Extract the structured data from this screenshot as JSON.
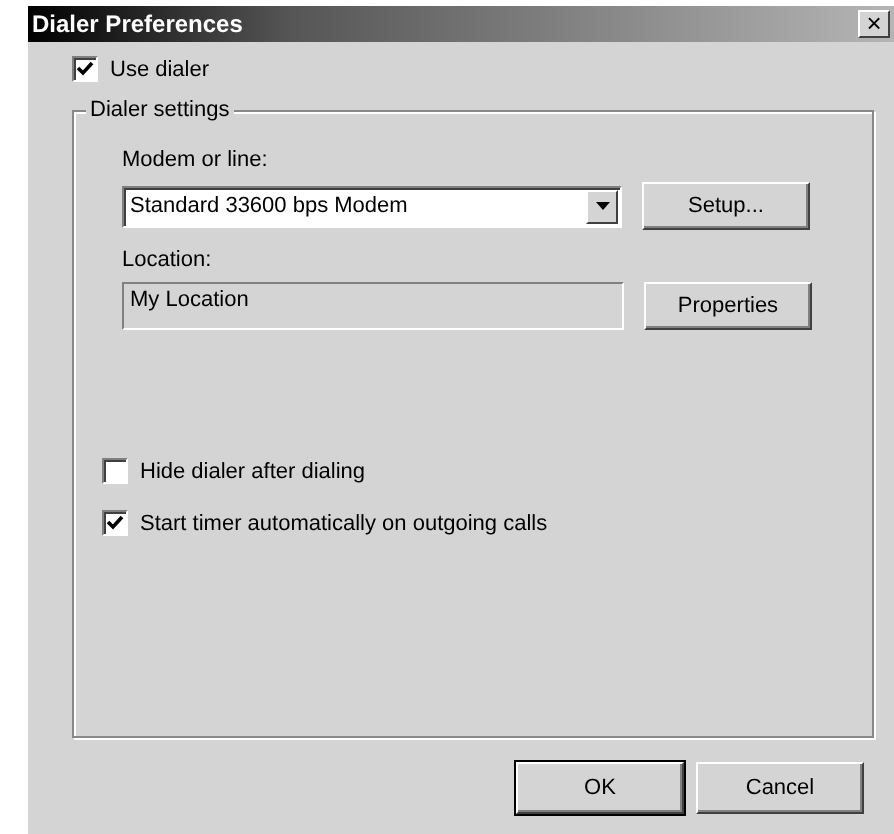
{
  "window": {
    "title": "Dialer Preferences",
    "close": "×"
  },
  "use_dialer": {
    "label": "Use dialer",
    "checked": true
  },
  "group": {
    "title": "Dialer settings",
    "modem": {
      "label": "Modem or line:",
      "value": "Standard 33600 bps Modem",
      "button": "Setup..."
    },
    "location": {
      "label": "Location:",
      "value": "My Location",
      "button": "Properties"
    },
    "options": [
      {
        "label": "Hide dialer after dialing",
        "checked": false
      },
      {
        "label": "Start timer automatically on outgoing calls",
        "checked": true
      }
    ]
  },
  "buttons": [
    {
      "label": "OK",
      "default": true
    },
    {
      "label": "Cancel",
      "default": false
    }
  ]
}
